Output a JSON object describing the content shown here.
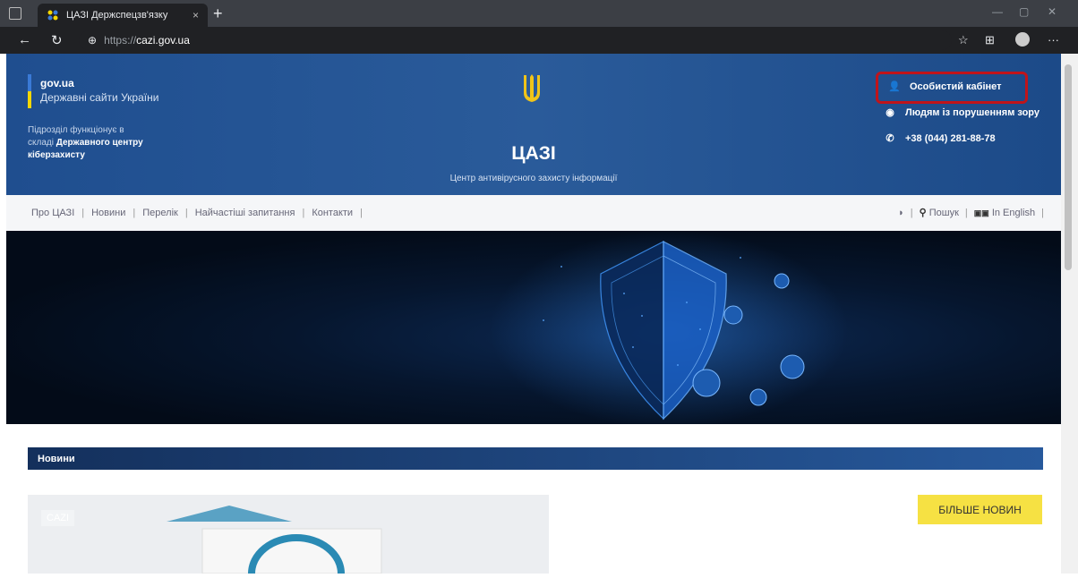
{
  "browser": {
    "tab_title": "ЦАЗІ Держспецзв'язку",
    "tab_close": "×",
    "new_tab": "+",
    "url_scheme": "https://",
    "url_domain": "cazi.gov.ua",
    "more": "···"
  },
  "header": {
    "gov_title": "gov.ua",
    "gov_subtitle": "Державні сайти України",
    "sub_line1": "Підрозділ функціонує в",
    "sub_line2": "складі",
    "sub_line2_bold": "Державного центру",
    "sub_line3": "кіберзахисту",
    "brand": "ЦАЗІ",
    "tagline": "Центр антивірусного захисту інформації",
    "cabinet": "Особистий кабінет",
    "accessibility": "Людям із порушенням зору",
    "phone": "+38 (044) 281-88-78"
  },
  "menu": {
    "items": [
      "Про ЦАЗІ",
      "Новини",
      "Перелік",
      "Найчастіші запитання",
      "Контакти"
    ],
    "search": "Пошук",
    "english": "In English"
  },
  "news": {
    "title": "Новини",
    "image_label": "CAZI",
    "more_button": "БІЛЬШЕ НОВИН"
  }
}
